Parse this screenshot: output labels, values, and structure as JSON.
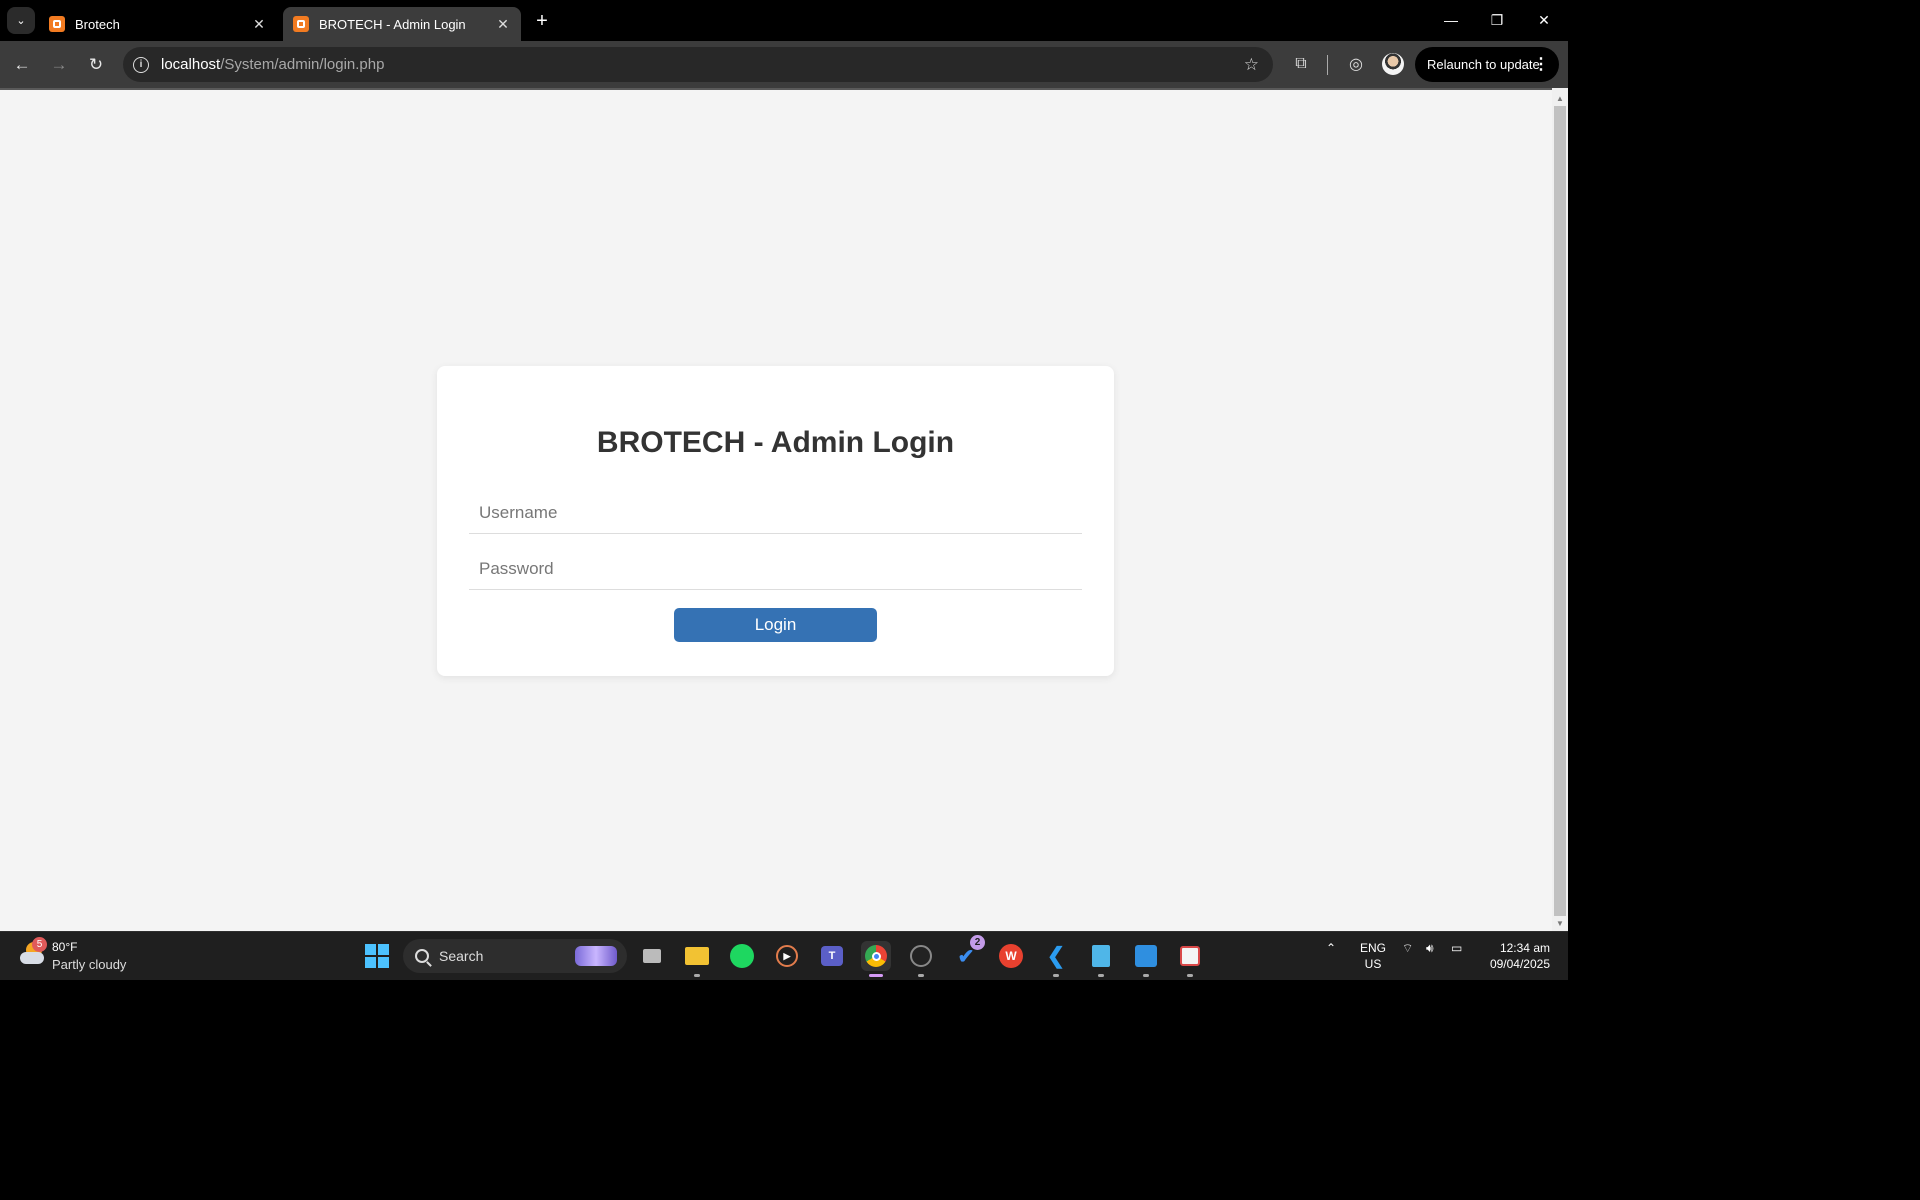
{
  "browser": {
    "tabs": [
      {
        "title": "Brotech",
        "active": false
      },
      {
        "title": "BROTECH - Admin Login",
        "active": true
      }
    ],
    "url_host": "localhost",
    "url_path": "/System/admin/login.php",
    "relaunch_label": "Relaunch to update"
  },
  "login": {
    "title": "BROTECH - Admin Login",
    "username_placeholder": "Username",
    "password_placeholder": "Password",
    "button_label": "Login",
    "button_color": "#3572b4"
  },
  "taskbar": {
    "weather": {
      "temp": "80°F",
      "desc": "Partly cloudy",
      "badge": "5"
    },
    "search_label": "Search",
    "todo_badge": "2",
    "lang_line1": "ENG",
    "lang_line2": "US",
    "time": "12:34 am",
    "date": "09/04/2025",
    "apps": [
      "task-view-icon",
      "file-explorer-icon",
      "spotify-icon",
      "media-player-icon",
      "teams-icon",
      "chrome-icon",
      "obs-icon",
      "todo-icon",
      "wps-icon",
      "vscode-icon",
      "notepad-icon",
      "paint-icon",
      "snipping-tool-icon"
    ]
  }
}
